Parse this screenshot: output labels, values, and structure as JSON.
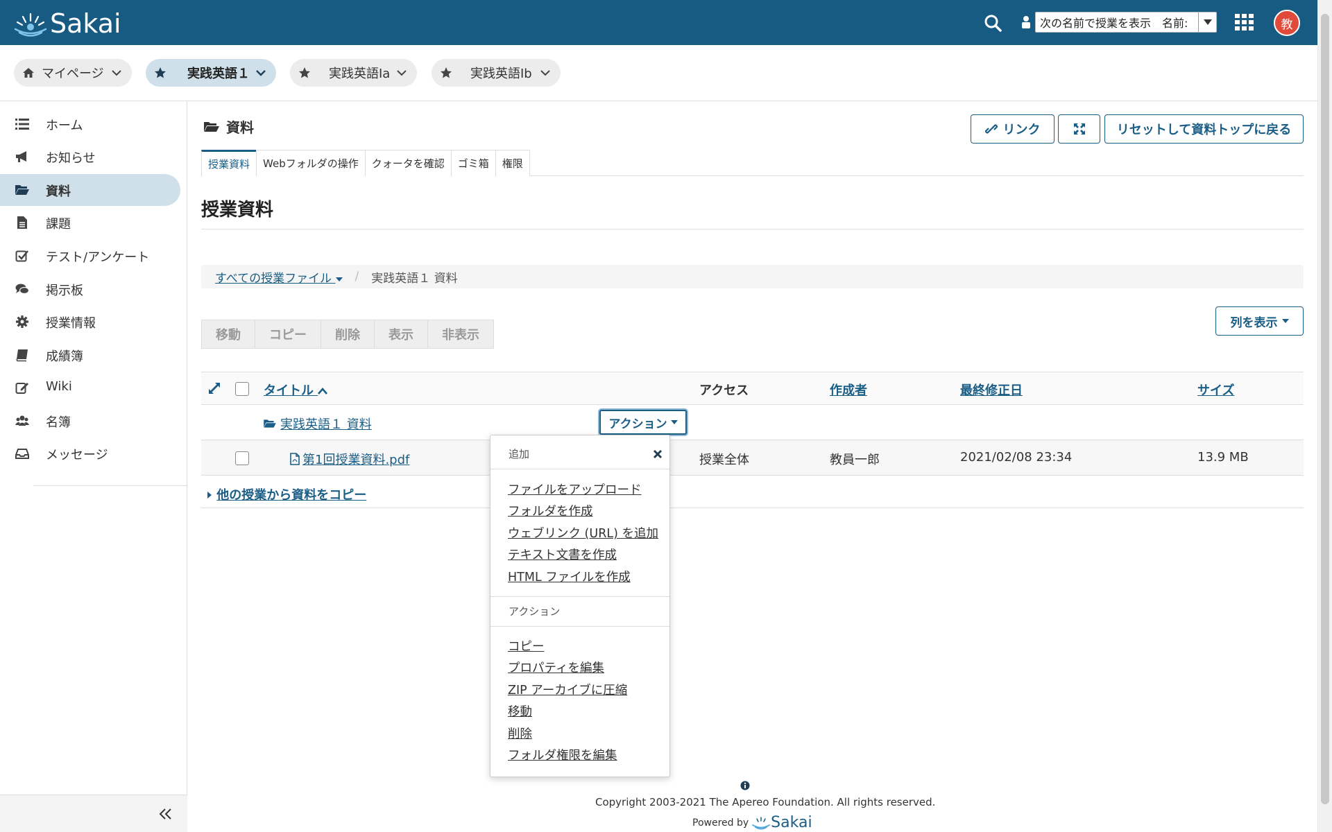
{
  "header": {
    "logo_text": "Sakai",
    "role_select_value": "次の名前で授業を表示　名前:",
    "avatar_initial": "教"
  },
  "sites": [
    {
      "label": "マイページ",
      "icon": "home-icon"
    },
    {
      "label": "実践英語１",
      "icon": "star-icon"
    },
    {
      "label": "実践英語Ia",
      "icon": "star-icon"
    },
    {
      "label": "実践英語Ib",
      "icon": "star-icon"
    }
  ],
  "sidebar": {
    "items": [
      {
        "label": "ホーム",
        "icon": "list-icon"
      },
      {
        "label": "お知らせ",
        "icon": "megaphone-icon"
      },
      {
        "label": "資料",
        "icon": "folder-open-icon"
      },
      {
        "label": "課題",
        "icon": "file-text-icon"
      },
      {
        "label": "テスト/アンケート",
        "icon": "check-square-icon"
      },
      {
        "label": "掲示板",
        "icon": "comments-icon"
      },
      {
        "label": "授業情報",
        "icon": "gear-icon"
      },
      {
        "label": "成績簿",
        "icon": "book-icon"
      },
      {
        "label": "Wiki",
        "icon": "edit-icon"
      },
      {
        "label": "名簿",
        "icon": "users-icon"
      },
      {
        "label": "メッセージ",
        "icon": "inbox-icon"
      }
    ]
  },
  "tool": {
    "title": "資料",
    "link_button": "リンク",
    "reset_button": "リセットして資料トップに戻る",
    "subtabs": [
      "授業資料",
      "Webフォルダの操作",
      "クォータを確認",
      "ゴミ箱",
      "権限"
    ],
    "heading": "授業資料",
    "breadcrumb_root": "すべての授業ファイル",
    "breadcrumb_current": "実践英語１ 資料",
    "bulk_buttons": [
      "移動",
      "コピー",
      "削除",
      "表示",
      "非表示"
    ],
    "columns_button": "列を表示"
  },
  "table": {
    "headers": {
      "title": "タイトル",
      "access": "アクセス",
      "author": "作成者",
      "modified": "最終修正日",
      "size": "サイズ"
    },
    "folder": {
      "name": "実践英語１ 資料",
      "action_button": "アクション"
    },
    "file": {
      "name": "第1回授業資料.pdf",
      "access": "授業全体",
      "author": "教員一郎",
      "modified": "2021/02/08 23:34",
      "size": "13.9 MB"
    },
    "copy_link": "他の授業から資料をコピー"
  },
  "dropdown": {
    "add_header": "追加",
    "add_items": [
      "ファイルをアップロード",
      "フォルダを作成",
      "ウェブリンク (URL) を追加",
      "テキスト文書を作成",
      "HTML ファイルを作成"
    ],
    "action_header": "アクション",
    "action_items": [
      "コピー",
      "プロパティを編集",
      "ZIP アーカイブに圧縮",
      "移動",
      "削除",
      "フォルダ権限を編集"
    ]
  },
  "footer": {
    "copyright": "Copyright 2003-2021 The Apereo Foundation. All rights reserved.",
    "powered_by": "Powered by",
    "powered_logo": "Sakai"
  },
  "colors": {
    "brand": "#175b82",
    "link": "#1a5d86",
    "active_bg": "#cfe0ea",
    "avatar": "#e04a3a"
  }
}
